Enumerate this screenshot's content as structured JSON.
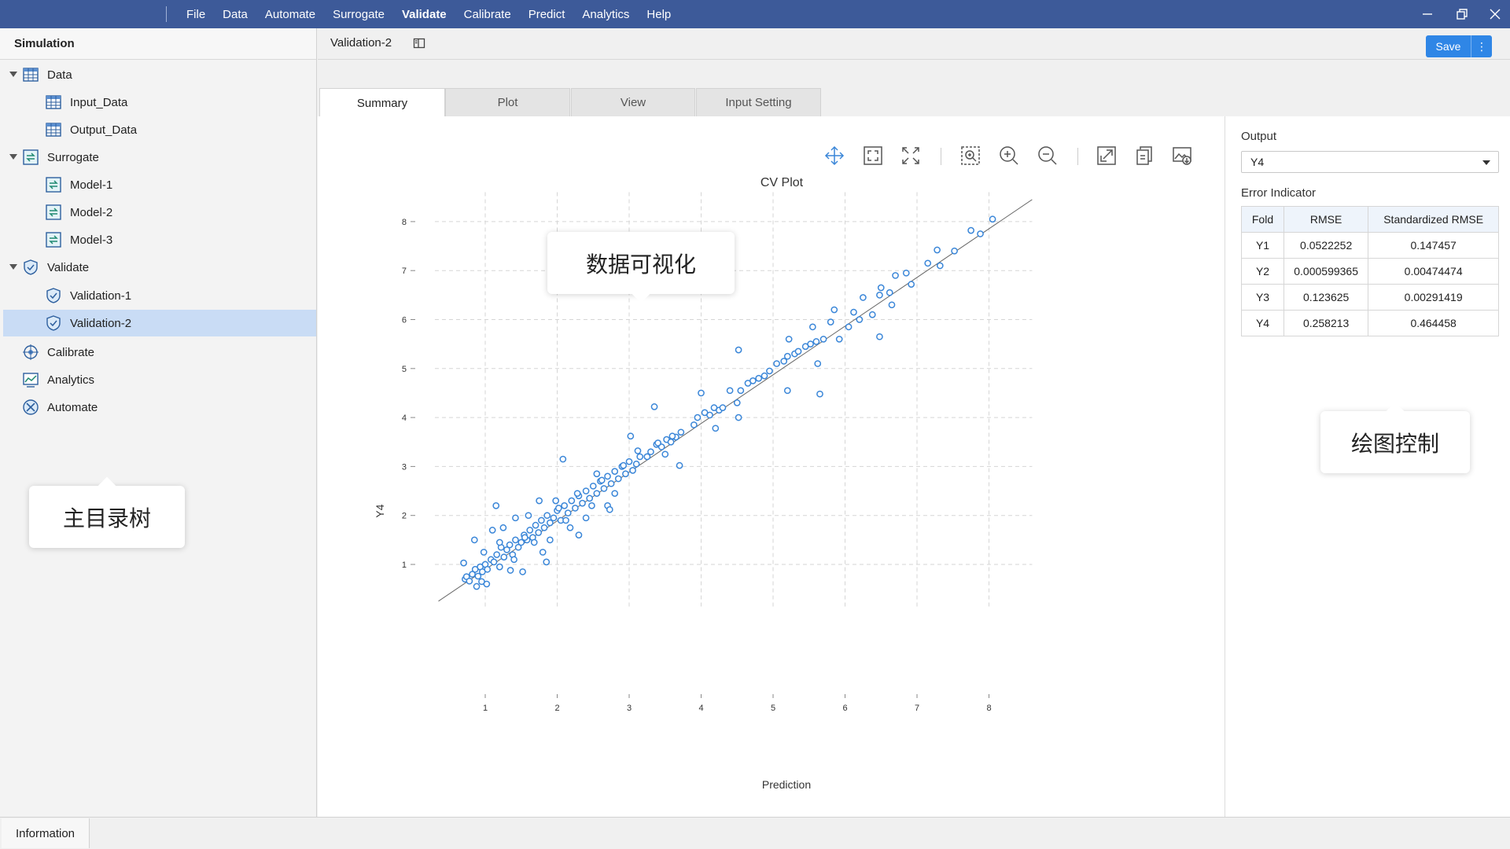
{
  "menubar": {
    "items": [
      "File",
      "Data",
      "Automate",
      "Surrogate",
      "Validate",
      "Calibrate",
      "Predict",
      "Analytics",
      "Help"
    ],
    "active": "Validate"
  },
  "left_panel": {
    "title": "Simulation",
    "tree": [
      {
        "label": "Data",
        "icon": "table-icon",
        "level": 0,
        "expanded": true
      },
      {
        "label": "Input_Data",
        "icon": "table-icon",
        "level": 1
      },
      {
        "label": "Output_Data",
        "icon": "table-icon",
        "level": 1
      },
      {
        "label": "Surrogate",
        "icon": "surrogate-icon",
        "level": 0,
        "expanded": true
      },
      {
        "label": "Model-1",
        "icon": "surrogate-icon",
        "level": 1
      },
      {
        "label": "Model-2",
        "icon": "surrogate-icon",
        "level": 1
      },
      {
        "label": "Model-3",
        "icon": "surrogate-icon",
        "level": 1
      },
      {
        "label": "Validate",
        "icon": "shield-icon",
        "level": 0,
        "expanded": true
      },
      {
        "label": "Validation-1",
        "icon": "shield-icon",
        "level": 1
      },
      {
        "label": "Validation-2",
        "icon": "shield-icon",
        "level": 1,
        "selected": true
      },
      {
        "label": "Calibrate",
        "icon": "crosshair-icon",
        "level": 0
      },
      {
        "label": "Analytics",
        "icon": "analytics-icon",
        "level": 0
      },
      {
        "label": "Automate",
        "icon": "automate-icon",
        "level": 0
      }
    ],
    "callout": "主目录树"
  },
  "document": {
    "tab_title": "Validation-2",
    "save_label": "Save",
    "more_label": "⋮",
    "subtabs": [
      "Summary",
      "Plot",
      "View",
      "Input Setting"
    ],
    "active_subtab": "Summary"
  },
  "plot": {
    "toolbar": [
      "pan-icon",
      "fit-icon",
      "expand-icon",
      "zoom-box-icon",
      "zoom-in-icon",
      "zoom-out-icon",
      "resize-icon",
      "copy-icon",
      "export-image-icon"
    ],
    "callout": "数据可视化"
  },
  "chart_data": {
    "type": "scatter",
    "title": "CV Plot",
    "xlabel": "Prediction",
    "ylabel": "Y4",
    "xticks": [
      1,
      2,
      3,
      4,
      5,
      6,
      7,
      8
    ],
    "yticks": [
      1,
      2,
      3,
      4,
      5,
      6,
      7,
      8
    ],
    "xlim": [
      0.3,
      8.6
    ],
    "ylim": [
      0.1,
      8.6
    ],
    "grid": true,
    "reference_line": {
      "x": [
        0.35,
        8.6
      ],
      "y": [
        0.25,
        8.45
      ]
    },
    "marker_color": "#3a86d8",
    "points": [
      [
        0.72,
        0.7
      ],
      [
        0.74,
        0.75
      ],
      [
        0.78,
        0.66
      ],
      [
        0.82,
        0.8
      ],
      [
        0.86,
        0.9
      ],
      [
        0.9,
        0.76
      ],
      [
        0.93,
        0.95
      ],
      [
        0.96,
        0.85
      ],
      [
        1.0,
        1.0
      ],
      [
        1.03,
        0.9
      ],
      [
        0.7,
        1.03
      ],
      [
        0.85,
        1.5
      ],
      [
        0.88,
        0.55
      ],
      [
        0.98,
        1.25
      ],
      [
        1.02,
        0.6
      ],
      [
        1.08,
        1.1
      ],
      [
        1.12,
        1.05
      ],
      [
        1.16,
        1.2
      ],
      [
        1.2,
        0.95
      ],
      [
        1.22,
        1.35
      ],
      [
        1.26,
        1.15
      ],
      [
        1.3,
        1.3
      ],
      [
        1.34,
        1.4
      ],
      [
        1.38,
        1.2
      ],
      [
        1.42,
        1.5
      ],
      [
        1.46,
        1.35
      ],
      [
        1.5,
        1.45
      ],
      [
        1.54,
        1.6
      ],
      [
        1.58,
        1.5
      ],
      [
        1.62,
        1.7
      ],
      [
        1.66,
        1.55
      ],
      [
        1.7,
        1.8
      ],
      [
        1.74,
        1.65
      ],
      [
        1.78,
        1.9
      ],
      [
        1.82,
        1.75
      ],
      [
        1.86,
        2.0
      ],
      [
        1.9,
        1.85
      ],
      [
        1.95,
        1.95
      ],
      [
        2.0,
        2.1
      ],
      [
        2.05,
        1.9
      ],
      [
        2.1,
        2.2
      ],
      [
        2.15,
        2.05
      ],
      [
        2.2,
        2.3
      ],
      [
        2.25,
        2.15
      ],
      [
        2.3,
        2.4
      ],
      [
        2.35,
        2.25
      ],
      [
        2.4,
        2.5
      ],
      [
        2.45,
        2.35
      ],
      [
        2.5,
        2.6
      ],
      [
        2.55,
        2.45
      ],
      [
        2.6,
        2.7
      ],
      [
        2.65,
        2.55
      ],
      [
        2.7,
        2.8
      ],
      [
        2.75,
        2.65
      ],
      [
        2.8,
        2.9
      ],
      [
        2.85,
        2.75
      ],
      [
        2.9,
        3.0
      ],
      [
        2.95,
        2.85
      ],
      [
        3.0,
        3.1
      ],
      [
        3.1,
        3.05
      ],
      [
        3.15,
        3.2
      ],
      [
        3.25,
        3.2
      ],
      [
        3.3,
        3.3
      ],
      [
        3.38,
        3.45
      ],
      [
        3.45,
        3.4
      ],
      [
        3.52,
        3.55
      ],
      [
        3.58,
        3.5
      ],
      [
        3.65,
        3.6
      ],
      [
        3.72,
        3.7
      ],
      [
        1.15,
        2.2
      ],
      [
        1.25,
        1.75
      ],
      [
        1.35,
        0.88
      ],
      [
        1.42,
        1.95
      ],
      [
        1.6,
        2.0
      ],
      [
        1.75,
        2.3
      ],
      [
        1.9,
        1.5
      ],
      [
        2.08,
        3.15
      ],
      [
        2.18,
        1.75
      ],
      [
        2.4,
        1.95
      ],
      [
        2.55,
        2.85
      ],
      [
        2.8,
        2.45
      ],
      [
        3.02,
        3.62
      ],
      [
        3.35,
        4.22
      ],
      [
        3.7,
        3.02
      ],
      [
        3.9,
        3.85
      ],
      [
        3.95,
        4.0
      ],
      [
        4.0,
        4.5
      ],
      [
        4.05,
        4.1
      ],
      [
        4.12,
        4.05
      ],
      [
        4.18,
        4.2
      ],
      [
        4.25,
        4.15
      ],
      [
        4.3,
        4.2
      ],
      [
        4.4,
        4.55
      ],
      [
        4.5,
        4.3
      ],
      [
        4.52,
        5.38
      ],
      [
        4.55,
        4.55
      ],
      [
        4.65,
        4.7
      ],
      [
        4.72,
        4.75
      ],
      [
        4.8,
        4.8
      ],
      [
        4.88,
        4.85
      ],
      [
        4.95,
        4.95
      ],
      [
        5.05,
        5.1
      ],
      [
        5.15,
        5.15
      ],
      [
        5.2,
        5.25
      ],
      [
        5.22,
        5.6
      ],
      [
        5.3,
        5.3
      ],
      [
        5.35,
        5.35
      ],
      [
        5.45,
        5.45
      ],
      [
        5.52,
        5.5
      ],
      [
        5.55,
        5.85
      ],
      [
        5.6,
        5.55
      ],
      [
        5.62,
        5.1
      ],
      [
        5.65,
        4.48
      ],
      [
        5.7,
        5.6
      ],
      [
        5.8,
        5.95
      ],
      [
        5.85,
        6.2
      ],
      [
        5.92,
        5.6
      ],
      [
        6.05,
        5.85
      ],
      [
        6.12,
        6.15
      ],
      [
        6.2,
        6.0
      ],
      [
        6.25,
        6.45
      ],
      [
        6.38,
        6.1
      ],
      [
        6.48,
        6.5
      ],
      [
        6.5,
        6.65
      ],
      [
        6.48,
        5.65
      ],
      [
        6.62,
        6.55
      ],
      [
        6.65,
        6.3
      ],
      [
        6.7,
        6.9
      ],
      [
        6.85,
        6.95
      ],
      [
        6.92,
        6.72
      ],
      [
        7.15,
        7.15
      ],
      [
        7.28,
        7.42
      ],
      [
        7.32,
        7.1
      ],
      [
        7.52,
        7.4
      ],
      [
        7.75,
        7.82
      ],
      [
        7.88,
        7.75
      ],
      [
        8.05,
        8.05
      ],
      [
        5.2,
        4.55
      ],
      [
        4.52,
        4.0
      ],
      [
        4.2,
        3.78
      ],
      [
        3.25,
        3.2
      ],
      [
        2.7,
        2.2
      ],
      [
        1.2,
        1.45
      ],
      [
        1.1,
        1.7
      ],
      [
        0.95,
        0.65
      ],
      [
        1.4,
        1.1
      ],
      [
        1.52,
        0.85
      ],
      [
        1.55,
        1.55
      ],
      [
        1.68,
        1.45
      ],
      [
        1.8,
        1.25
      ],
      [
        1.85,
        1.05
      ],
      [
        1.98,
        2.3
      ],
      [
        2.02,
        2.15
      ],
      [
        2.12,
        1.9
      ],
      [
        2.28,
        2.45
      ],
      [
        2.3,
        1.6
      ],
      [
        2.48,
        2.2
      ],
      [
        2.62,
        2.72
      ],
      [
        2.73,
        2.12
      ],
      [
        2.92,
        3.02
      ],
      [
        3.05,
        2.92
      ],
      [
        3.12,
        3.32
      ],
      [
        3.4,
        3.48
      ],
      [
        3.5,
        3.25
      ],
      [
        3.6,
        3.62
      ]
    ]
  },
  "right_panel": {
    "output_label": "Output",
    "output_value": "Y4",
    "error_label": "Error Indicator",
    "table": {
      "headers": [
        "Fold",
        "RMSE",
        "Standardized RMSE"
      ],
      "rows": [
        [
          "Y1",
          "0.0522252",
          "0.147457"
        ],
        [
          "Y2",
          "0.000599365",
          "0.00474474"
        ],
        [
          "Y3",
          "0.123625",
          "0.00291419"
        ],
        [
          "Y4",
          "0.258213",
          "0.464458"
        ]
      ]
    },
    "callout": "绘图控制"
  },
  "bottom": {
    "tab": "Information"
  },
  "colors": {
    "menubar": "#3d5a99",
    "accent": "#2f86e6",
    "marker": "#3a86d8",
    "selected": "#c9dcf5"
  }
}
